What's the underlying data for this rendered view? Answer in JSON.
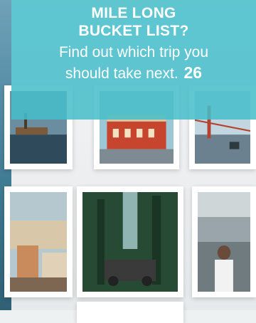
{
  "banner": {
    "headline_line1": "MILE LONG",
    "headline_line2": "BUCKET LIST?",
    "sub_line1": "Find out which trip you",
    "sub_line2": "should take next.",
    "number": "26"
  },
  "colors": {
    "banner_overlay": "#46bec9",
    "text": "#ffffff",
    "board_background": "#eef1f2"
  }
}
